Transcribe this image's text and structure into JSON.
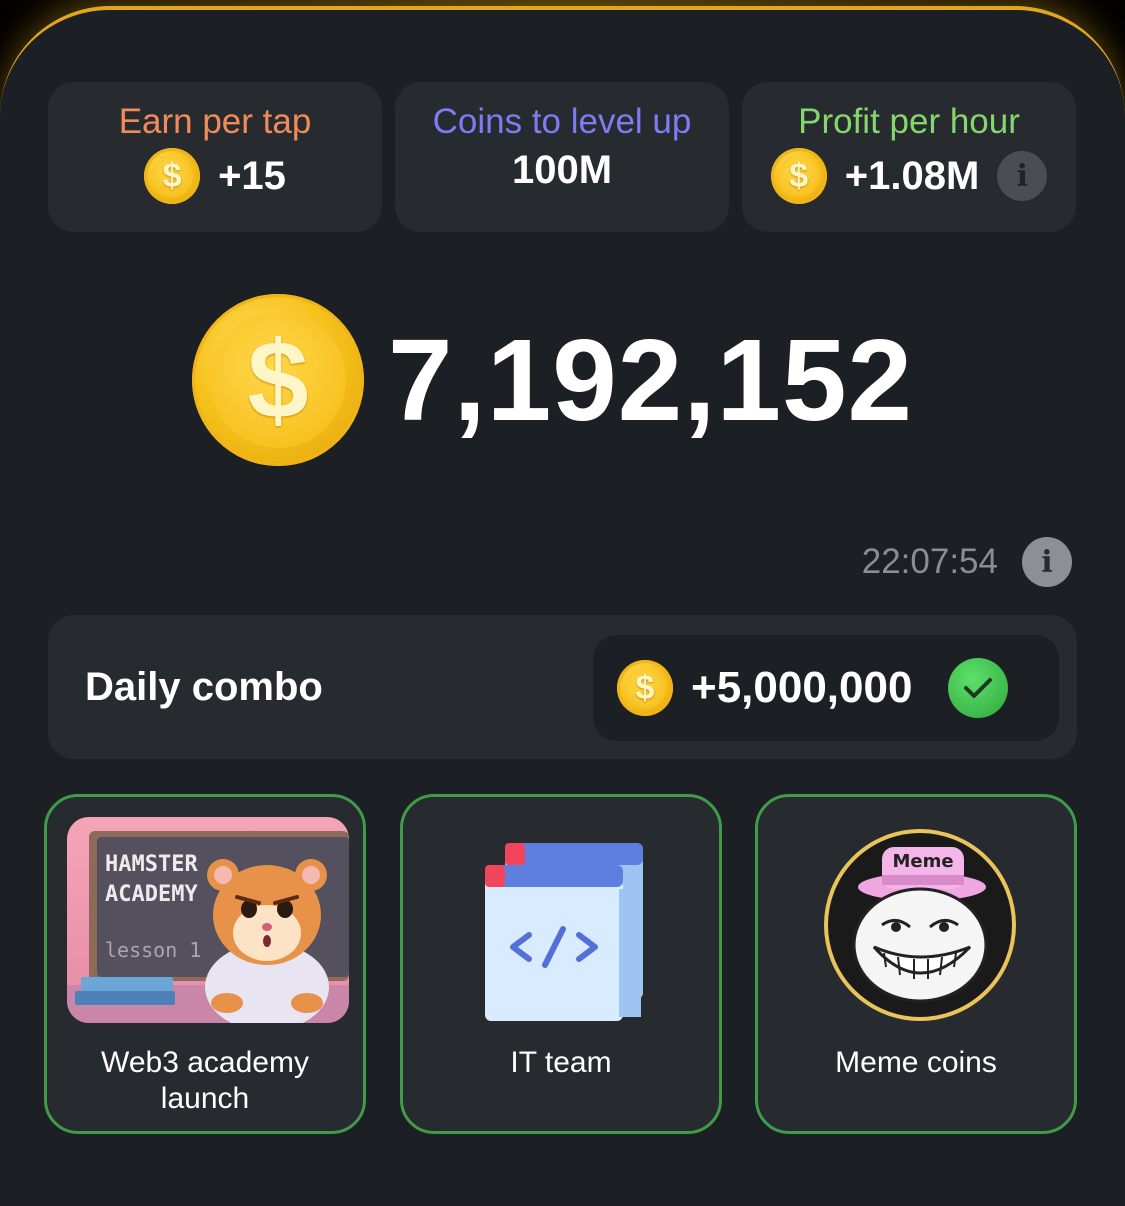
{
  "stats": {
    "earn_per_tap": {
      "label": "Earn per tap",
      "value": "+15",
      "color": "#f08c5a"
    },
    "coins_to_level": {
      "label": "Coins to level up",
      "value": "100M",
      "color": "#7e7cf2"
    },
    "profit_per_hour": {
      "label": "Profit per hour",
      "value": "+1.08M",
      "color": "#84d76c"
    }
  },
  "balance": {
    "value": "7,192,152"
  },
  "timer": {
    "value": "22:07:54"
  },
  "daily_combo": {
    "title": "Daily combo",
    "reward": "+5,000,000",
    "status": "claimed"
  },
  "cards": [
    {
      "label": "Web3 academy launch",
      "image_text": [
        "HAMSTER",
        "ACADEMY",
        "lesson 1"
      ]
    },
    {
      "label": "IT team",
      "icon": "code-window-icon"
    },
    {
      "label": "Meme coins",
      "image_text": "Meme"
    }
  ],
  "colors": {
    "accent_gold": "#e0a71c",
    "card_border_green": "#3f9b47",
    "coin": "#f7c21d"
  }
}
